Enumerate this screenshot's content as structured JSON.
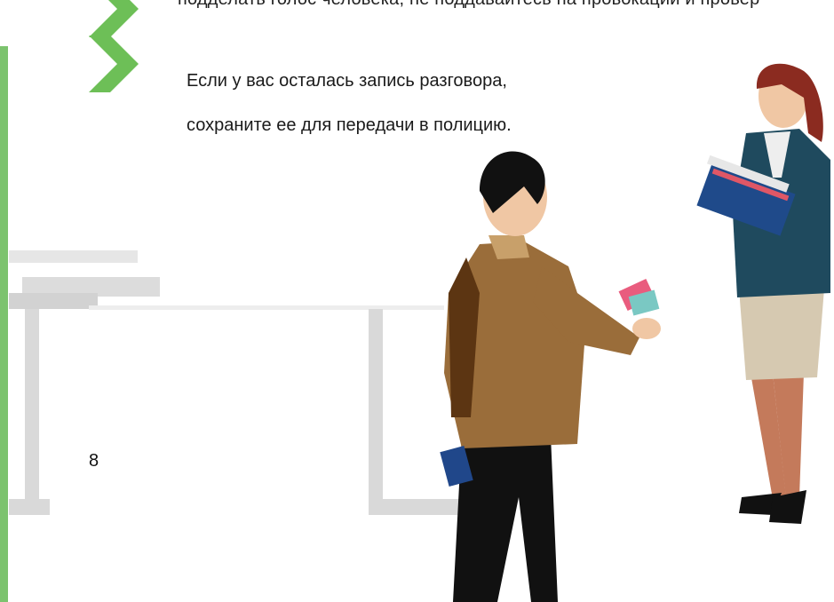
{
  "document": {
    "clipped_line": "подделать голос человека, не поддавайтесь на провокации и провер",
    "paragraph": {
      "line1": "Если у вас осталась запись разговора,",
      "line2": "сохраните ее для передачи в полицию."
    },
    "page_number": "8"
  },
  "colors": {
    "accent_green": "#7cc36e",
    "chevron_green": "#6dbf57",
    "desk_gray": "#d9d9d9",
    "man_jacket": "#9a6d3a",
    "woman_jacket": "#1f4a5e",
    "woman_skirt": "#d6c9b1",
    "hair_red": "#8b2b20"
  },
  "icons": {
    "bullet": "chevron-right-icon"
  }
}
